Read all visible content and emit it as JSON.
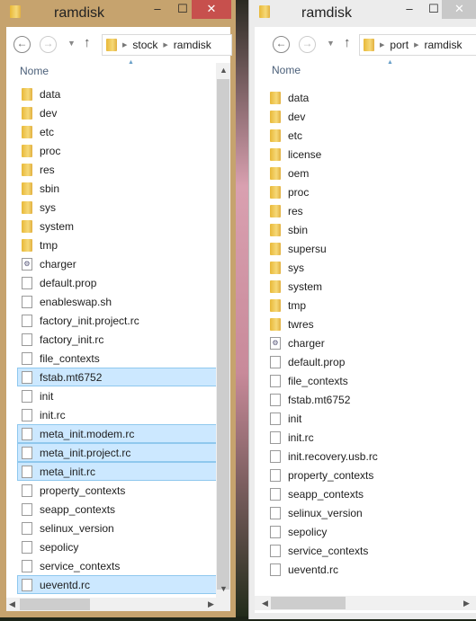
{
  "left": {
    "title": "ramdisk",
    "path": [
      "stock",
      "ramdisk"
    ],
    "column": "Nome",
    "items": [
      {
        "name": "data",
        "type": "folder"
      },
      {
        "name": "dev",
        "type": "folder"
      },
      {
        "name": "etc",
        "type": "folder"
      },
      {
        "name": "proc",
        "type": "folder"
      },
      {
        "name": "res",
        "type": "folder"
      },
      {
        "name": "sbin",
        "type": "folder"
      },
      {
        "name": "sys",
        "type": "folder"
      },
      {
        "name": "system",
        "type": "folder"
      },
      {
        "name": "tmp",
        "type": "folder"
      },
      {
        "name": "charger",
        "type": "exe"
      },
      {
        "name": "default.prop",
        "type": "file"
      },
      {
        "name": "enableswap.sh",
        "type": "file"
      },
      {
        "name": "factory_init.project.rc",
        "type": "file"
      },
      {
        "name": "factory_init.rc",
        "type": "file"
      },
      {
        "name": "file_contexts",
        "type": "file"
      },
      {
        "name": "fstab.mt6752",
        "type": "file",
        "selected": true
      },
      {
        "name": "init",
        "type": "file"
      },
      {
        "name": "init.rc",
        "type": "file"
      },
      {
        "name": "meta_init.modem.rc",
        "type": "file",
        "selected": true
      },
      {
        "name": "meta_init.project.rc",
        "type": "file",
        "selected": true
      },
      {
        "name": "meta_init.rc",
        "type": "file",
        "selected": true
      },
      {
        "name": "property_contexts",
        "type": "file"
      },
      {
        "name": "seapp_contexts",
        "type": "file"
      },
      {
        "name": "selinux_version",
        "type": "file"
      },
      {
        "name": "sepolicy",
        "type": "file"
      },
      {
        "name": "service_contexts",
        "type": "file"
      },
      {
        "name": "ueventd.rc",
        "type": "file",
        "selected": true
      }
    ]
  },
  "right": {
    "title": "ramdisk",
    "path": [
      "port",
      "ramdisk"
    ],
    "column": "Nome",
    "items": [
      {
        "name": "data",
        "type": "folder"
      },
      {
        "name": "dev",
        "type": "folder"
      },
      {
        "name": "etc",
        "type": "folder"
      },
      {
        "name": "license",
        "type": "folder"
      },
      {
        "name": "oem",
        "type": "folder"
      },
      {
        "name": "proc",
        "type": "folder"
      },
      {
        "name": "res",
        "type": "folder"
      },
      {
        "name": "sbin",
        "type": "folder"
      },
      {
        "name": "supersu",
        "type": "folder"
      },
      {
        "name": "sys",
        "type": "folder"
      },
      {
        "name": "system",
        "type": "folder"
      },
      {
        "name": "tmp",
        "type": "folder"
      },
      {
        "name": "twres",
        "type": "folder"
      },
      {
        "name": "charger",
        "type": "exe"
      },
      {
        "name": "default.prop",
        "type": "file"
      },
      {
        "name": "file_contexts",
        "type": "file"
      },
      {
        "name": "fstab.mt6752",
        "type": "file"
      },
      {
        "name": "init",
        "type": "file"
      },
      {
        "name": "init.rc",
        "type": "file"
      },
      {
        "name": "init.recovery.usb.rc",
        "type": "file"
      },
      {
        "name": "property_contexts",
        "type": "file"
      },
      {
        "name": "seapp_contexts",
        "type": "file"
      },
      {
        "name": "selinux_version",
        "type": "file"
      },
      {
        "name": "sepolicy",
        "type": "file"
      },
      {
        "name": "service_contexts",
        "type": "file"
      },
      {
        "name": "ueventd.rc",
        "type": "file"
      }
    ]
  },
  "colors": {
    "active_frame": "#c6a36e",
    "inactive_frame": "#ececec",
    "close": "#c7504d",
    "selection": "#cce8ff"
  }
}
